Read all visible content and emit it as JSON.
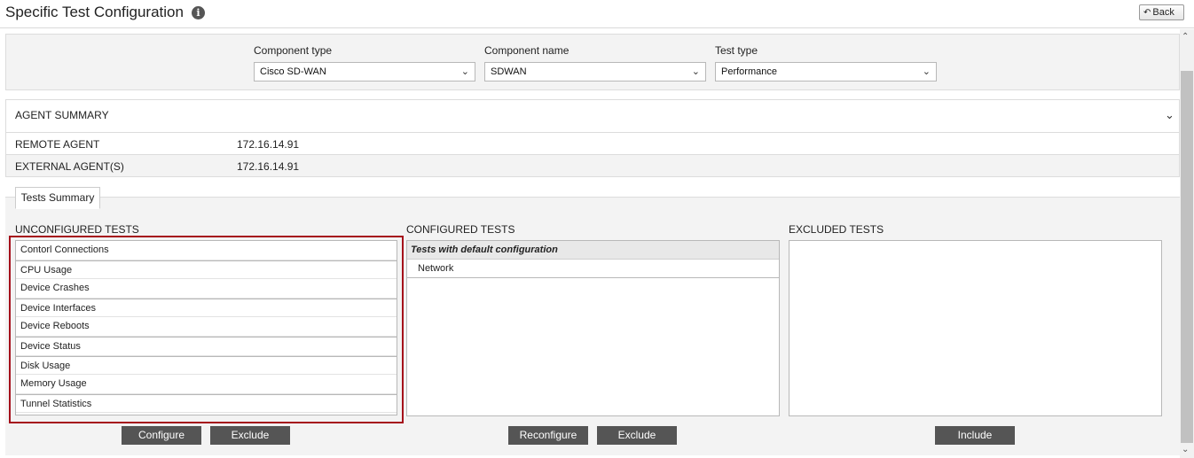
{
  "header": {
    "title": "Specific Test Configuration",
    "back_label": "Back"
  },
  "config": {
    "component_type": {
      "label": "Component type",
      "value": "Cisco SD-WAN"
    },
    "component_name": {
      "label": "Component name",
      "value": "SDWAN"
    },
    "test_type": {
      "label": "Test type",
      "value": "Performance"
    }
  },
  "agent_summary": {
    "title": "AGENT SUMMARY",
    "rows": [
      {
        "key": "REMOTE AGENT",
        "value": "172.16.14.91"
      },
      {
        "key": "EXTERNAL AGENT(S)",
        "value": "172.16.14.91"
      }
    ]
  },
  "tests": {
    "tab_label": "Tests Summary",
    "unconfigured": {
      "title": "UNCONFIGURED TESTS",
      "items": [
        "Contorl Connections",
        "CPU Usage",
        "Device Crashes",
        "Device Interfaces",
        "Device Reboots",
        "Device Status",
        "Disk Usage",
        "Memory Usage",
        "Tunnel Statistics"
      ],
      "buttons": [
        "Configure",
        "Exclude"
      ]
    },
    "configured": {
      "title": "CONFIGURED TESTS",
      "group_header": "Tests with default configuration",
      "items": [
        "Network"
      ],
      "buttons": [
        "Reconfigure",
        "Exclude"
      ]
    },
    "excluded": {
      "title": "EXCLUDED TESTS",
      "items": [],
      "buttons": [
        "Include"
      ]
    }
  }
}
